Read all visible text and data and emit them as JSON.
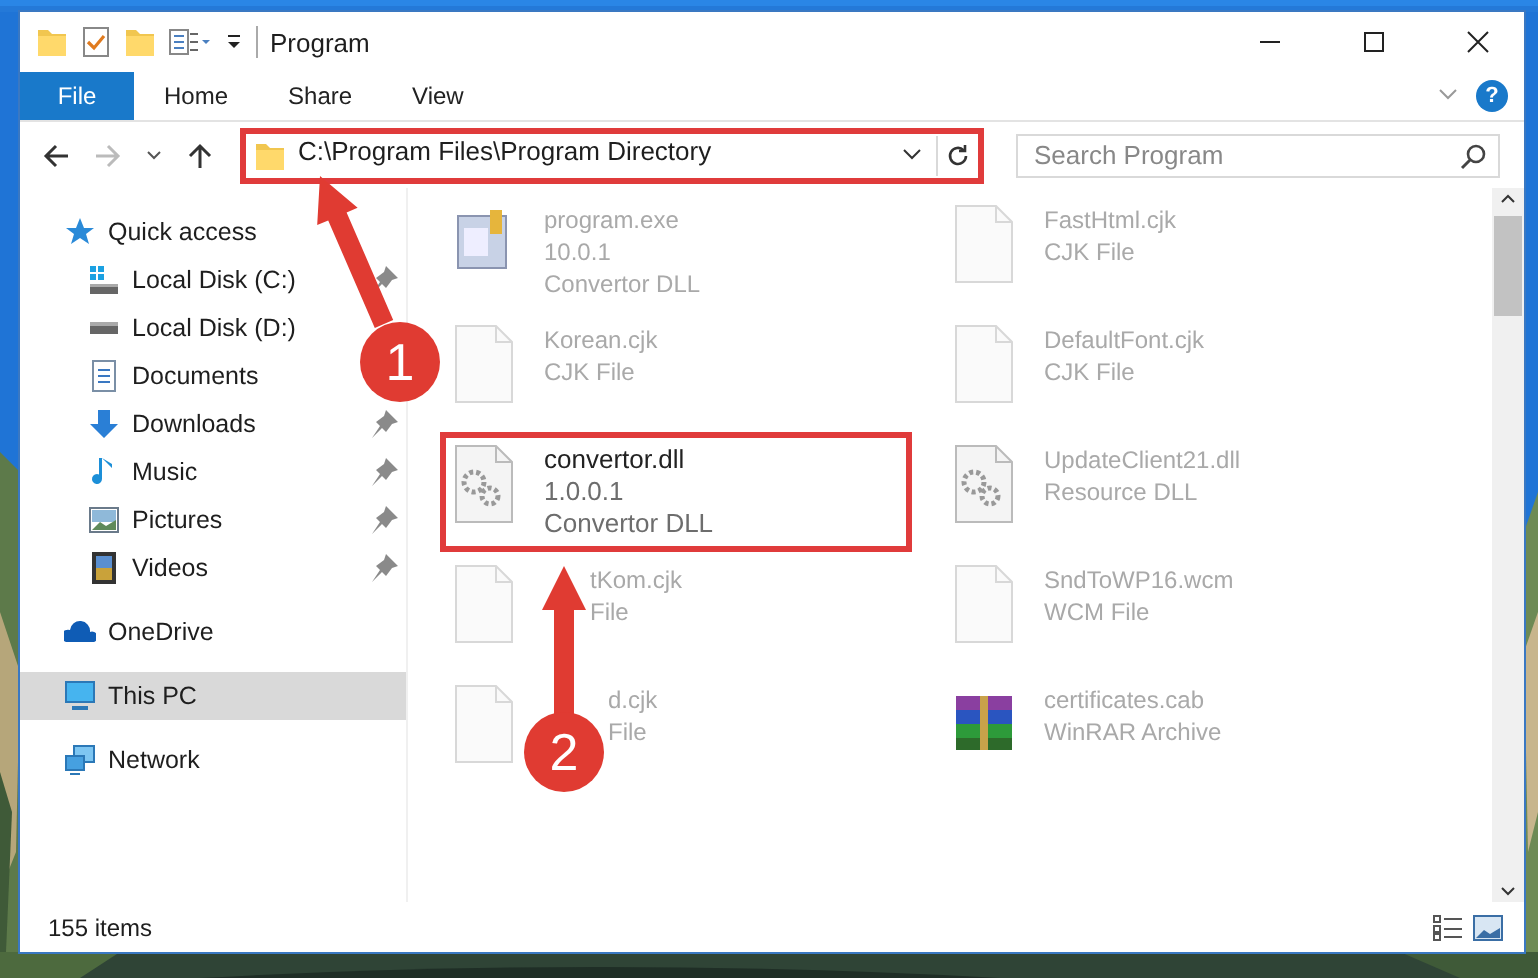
{
  "window": {
    "title": "Program"
  },
  "ribbon": {
    "tabs": [
      {
        "label": "File",
        "selected": true
      },
      {
        "label": "Home",
        "selected": false
      },
      {
        "label": "Share",
        "selected": false
      },
      {
        "label": "View",
        "selected": false
      }
    ],
    "help": "?"
  },
  "address": {
    "path": "C:\\Program Files\\Program Directory",
    "highlighted": true
  },
  "search": {
    "placeholder": "Search Program"
  },
  "sidebar": {
    "items": [
      {
        "label": "Quick access",
        "kind": "star",
        "selected": false,
        "children": [
          {
            "label": "Local Disk (C:)",
            "kind": "drive-c",
            "pinned": true,
            "selected": false
          },
          {
            "label": "Local Disk (D:)",
            "kind": "drive",
            "pinned": false,
            "selected": false
          },
          {
            "label": "Documents",
            "kind": "documents",
            "pinned": false,
            "selected": false
          },
          {
            "label": "Downloads",
            "kind": "downloads",
            "pinned": true,
            "selected": false
          },
          {
            "label": "Music",
            "kind": "music",
            "pinned": true,
            "selected": false
          },
          {
            "label": "Pictures",
            "kind": "pictures",
            "pinned": true,
            "selected": false
          },
          {
            "label": "Videos",
            "kind": "videos",
            "pinned": true,
            "selected": false
          }
        ]
      },
      {
        "label": "OneDrive",
        "kind": "cloud",
        "selected": false
      },
      {
        "label": "This PC",
        "kind": "pc",
        "selected": true
      },
      {
        "label": "Network",
        "kind": "network",
        "selected": false
      }
    ]
  },
  "files": [
    {
      "name": "program.exe",
      "lines": [
        "10.0.1",
        "Convertor DLL"
      ],
      "kind": "exe",
      "highlighted": false
    },
    {
      "name": "FastHtml.cjk",
      "lines": [
        "CJK File"
      ],
      "kind": "blank",
      "highlighted": false
    },
    {
      "name": "Korean.cjk",
      "lines": [
        "CJK File"
      ],
      "kind": "blank",
      "highlighted": false
    },
    {
      "name": "DefaultFont.cjk",
      "lines": [
        "CJK File"
      ],
      "kind": "blank",
      "highlighted": false
    },
    {
      "name": "convertor.dll",
      "lines": [
        "1.0.0.1",
        "Convertor DLL"
      ],
      "kind": "gear",
      "highlighted": true
    },
    {
      "name": "UpdateClient21.dll",
      "lines": [
        "Resource DLL"
      ],
      "kind": "gear",
      "highlighted": false
    },
    {
      "name": "tKom.cjk",
      "lines": [
        "File"
      ],
      "kind": "blank",
      "highlighted": false
    },
    {
      "name": "SndToWP16.wcm",
      "lines": [
        "WCM File"
      ],
      "kind": "blank",
      "highlighted": false
    },
    {
      "name": "d.cjk",
      "lines": [
        "File"
      ],
      "kind": "blank",
      "highlighted": false
    },
    {
      "name": "certificates.cab",
      "lines": [
        "WinRAR Archive"
      ],
      "kind": "archive",
      "highlighted": false
    }
  ],
  "status_bar": {
    "count": "155 items"
  },
  "annotations": [
    {
      "number": "1"
    },
    {
      "number": "2"
    }
  ]
}
